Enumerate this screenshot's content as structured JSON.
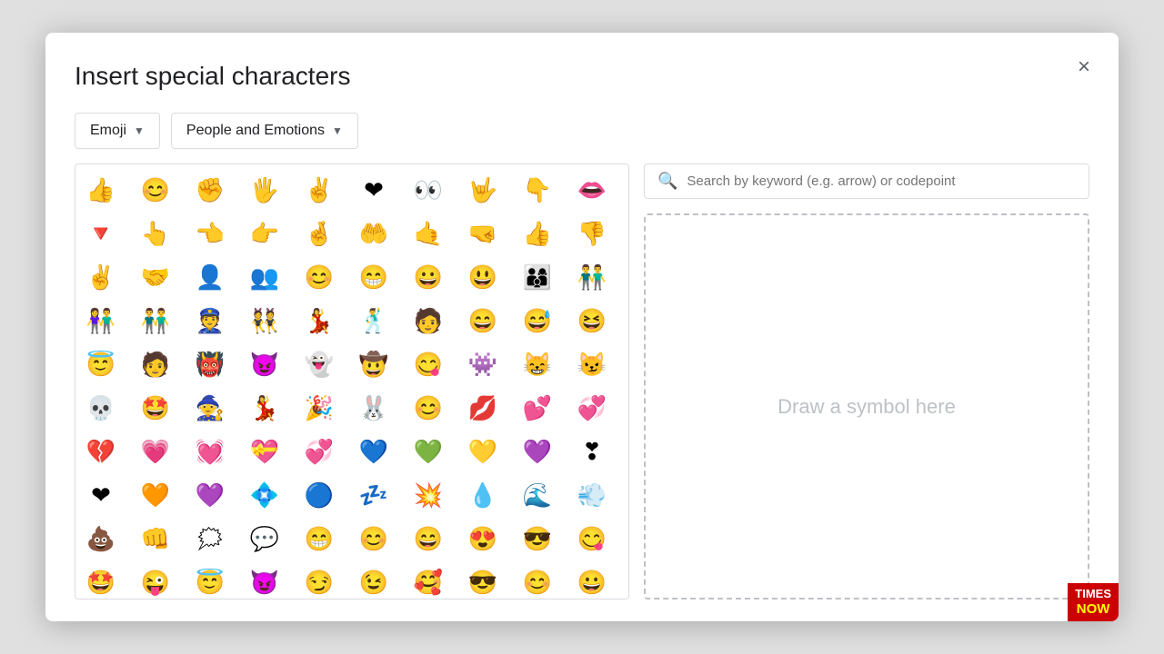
{
  "dialog": {
    "title": "Insert special characters",
    "close_label": "×"
  },
  "dropdowns": {
    "category_label": "Emoji",
    "subcategory_label": "People and Emotions"
  },
  "search": {
    "placeholder": "Search by keyword (e.g. arrow) or codepoint"
  },
  "draw_area": {
    "hint": "Draw a symbol here"
  },
  "emojis": [
    "👍",
    "😊",
    "✊",
    "🖐",
    "✌",
    "❤",
    "👀",
    "🤟",
    "👇",
    "👄",
    "🔻",
    "👆",
    "👈",
    "👉",
    "🤞",
    "🤲",
    "🤙",
    "🤜",
    "👍",
    "👎",
    "✌",
    "🤝",
    "👤",
    "👥",
    "😊",
    "😁",
    "😀",
    "😃",
    "👨‍👩‍👦",
    "👬",
    "👫",
    "👬",
    "👮",
    "👯",
    "💃",
    "🕺",
    "🧑",
    "😄",
    "😅",
    "😆",
    "😇",
    "🧑",
    "👹",
    "😈",
    "👻",
    "🤠",
    "😋",
    "👾",
    "😸",
    "😼",
    "💀",
    "🤩",
    "🧙",
    "💃",
    "🎉",
    "🐰",
    "😊",
    "💋",
    "💕",
    "💞",
    "💔",
    "💗",
    "💓",
    "💝",
    "💞",
    "💙",
    "💚",
    "💛",
    "💜",
    "❣",
    "❤",
    "🧡",
    "💜",
    "💠",
    "🔵",
    "💤",
    "💥",
    "💧",
    "🌊",
    "💨",
    "💩",
    "👊",
    "🗯",
    "💬",
    "😁",
    "😊",
    "😄",
    "😍",
    "😎",
    "😋",
    "🤩",
    "😜",
    "😇",
    "😈",
    "😏",
    "😉",
    "🥰",
    "😎",
    "😊",
    "😀"
  ],
  "badge": {
    "times": "TIMES",
    "now": "NOW"
  }
}
